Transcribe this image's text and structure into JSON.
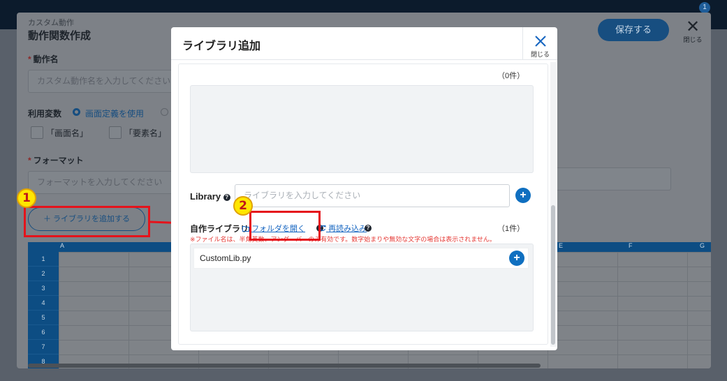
{
  "top_badge": "1",
  "background": {
    "subtitle": "カスタム動作",
    "title": "動作関数作成",
    "save_label": "保存する",
    "close_label": "閉じる",
    "action_name_label": "動作名",
    "action_name_placeholder": "カスタム動作名を入力してください",
    "variables_label": "利用変数",
    "radio_selected_label": "画面定義を使用",
    "check_1": "「画面名」",
    "check_2": "「要素名」",
    "format_label": "フォーマット",
    "format_placeholder": "フォーマットを入力してください",
    "add_library_label": "＋ ライブラリを追加する",
    "grid_columns": [
      "A",
      "E",
      "F",
      "G"
    ],
    "grid_rows": [
      "1",
      "2",
      "3",
      "4",
      "5",
      "6",
      "7",
      "8"
    ]
  },
  "annotations": {
    "step1": "1",
    "step2": "2"
  },
  "modal": {
    "title": "ライブラリ追加",
    "close_label": "閉じる",
    "top_count": "（0件）",
    "library_label": "Library",
    "library_placeholder": "ライブラリを入力してください",
    "my_library_label": "自作ライブラリ",
    "open_folder_label": "フォルダを開く",
    "reload_label": "再読み込み",
    "my_library_count": "（1件）",
    "note": "※ファイル名は、半角英数、アンダーバーのみ有効です。数字始まりや無効な文字の場合は表示されません。",
    "items": [
      "CustomLib.py"
    ],
    "help_glyph": "?",
    "plus_glyph": "+"
  },
  "colors": {
    "accent": "#0f6fc0",
    "annotation_red": "#e5131b",
    "annotation_yellow": "#ffe600"
  }
}
